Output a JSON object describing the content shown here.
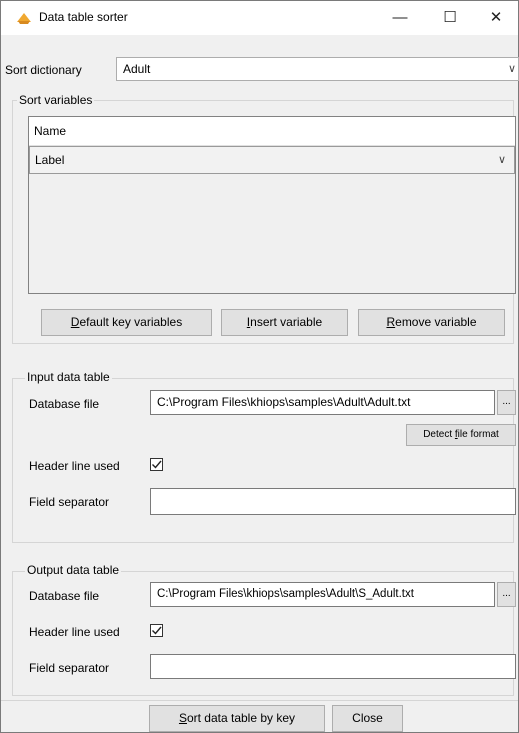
{
  "window": {
    "title": "Data table sorter",
    "minimize_glyph": "—",
    "maximize_glyph": "☐",
    "close_glyph": "✕"
  },
  "sort_dictionary": {
    "label": "Sort dictionary",
    "value": "Adult"
  },
  "sort_variables": {
    "legend": "Sort variables",
    "columns": [
      "Name"
    ],
    "rows": [
      "Label"
    ],
    "buttons": {
      "default": {
        "key": "D",
        "rest": "efault key variables"
      },
      "insert": {
        "key": "I",
        "rest": "nsert variable"
      },
      "remove": {
        "key": "R",
        "rest": "emove variable"
      }
    }
  },
  "input_table": {
    "legend": "Input data table",
    "database_file_label": "Database file",
    "database_file_value": "C:\\Program Files\\khiops\\samples\\Adult\\Adult.txt",
    "browse_label": "...",
    "detect_button": {
      "before": "Detect ",
      "key": "f",
      "after": "ile format"
    },
    "header_line_label": "Header line used",
    "header_line_checked": true,
    "field_separator_label": "Field separator",
    "field_separator_value": ""
  },
  "output_table": {
    "legend": "Output data table",
    "database_file_label": "Database file",
    "database_file_value": "C:\\Program Files\\khiops\\samples\\Adult\\S_Adult.txt",
    "browse_label": "...",
    "header_line_label": "Header line used",
    "header_line_checked": true,
    "field_separator_label": "Field separator",
    "field_separator_value": ""
  },
  "footer": {
    "sort_button": {
      "key": "S",
      "rest": "ort data table by key"
    },
    "close_label": "Close"
  },
  "icons": {
    "app": "app-icon",
    "chevron": "chevron-down-icon",
    "check": "checkmark-icon"
  },
  "colors": {
    "window_bg": "#f0f0f0",
    "accent_icon": "#f0a830"
  }
}
